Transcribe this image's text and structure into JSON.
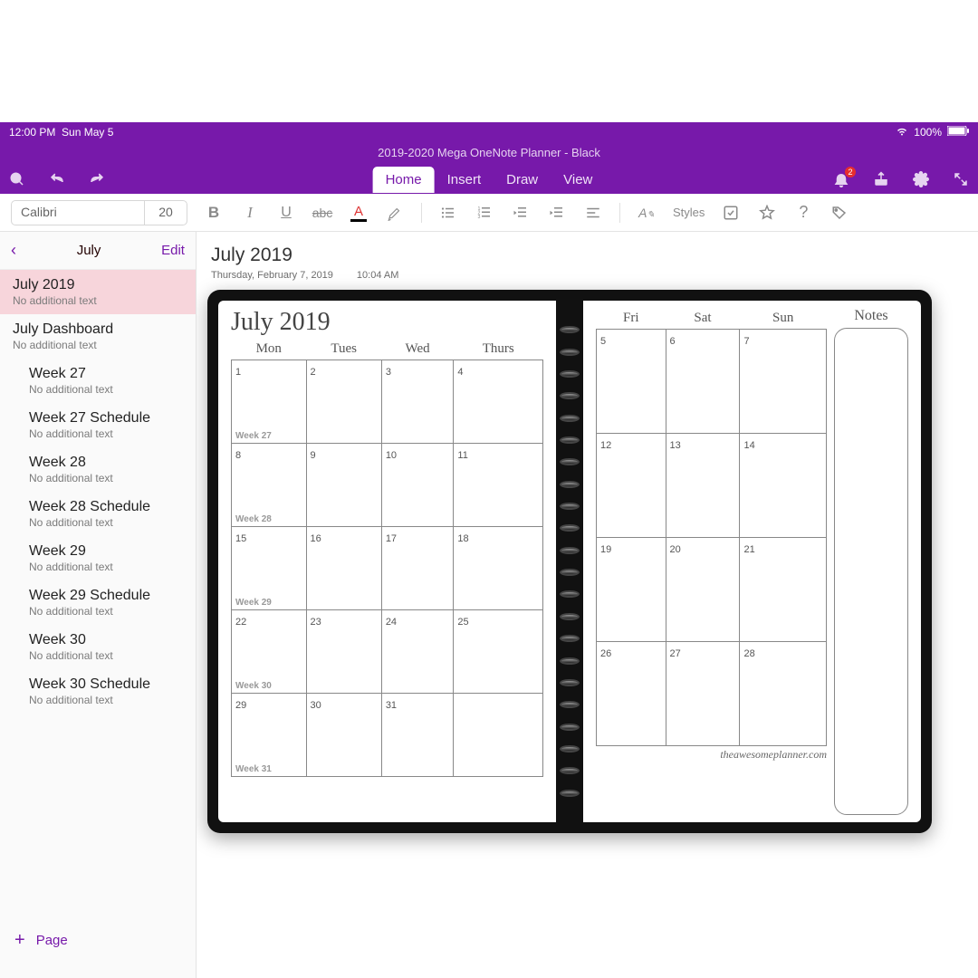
{
  "status": {
    "time": "12:00 PM",
    "date": "Sun May 5",
    "wifi": true,
    "battery_pct": "100%"
  },
  "title": "2019-2020 Mega OneNote Planner - Black",
  "tabs": [
    "Home",
    "Insert",
    "Draw",
    "View"
  ],
  "active_tab": "Home",
  "notifications_badge": "2",
  "toolbar": {
    "font_name": "Calibri",
    "font_size": "20",
    "styles_label": "Styles"
  },
  "sidebar": {
    "back_section": "July",
    "edit_label": "Edit",
    "items": [
      {
        "name": "July 2019",
        "sub": "No additional text",
        "selected": true,
        "indent": false
      },
      {
        "name": "July Dashboard",
        "sub": "No additional text",
        "selected": false,
        "indent": false
      },
      {
        "name": "Week 27",
        "sub": "No additional text",
        "selected": false,
        "indent": true
      },
      {
        "name": "Week 27 Schedule",
        "sub": "No additional text",
        "selected": false,
        "indent": true
      },
      {
        "name": "Week 28",
        "sub": "No additional text",
        "selected": false,
        "indent": true
      },
      {
        "name": "Week 28 Schedule",
        "sub": "No additional text",
        "selected": false,
        "indent": true
      },
      {
        "name": "Week 29",
        "sub": "No additional text",
        "selected": false,
        "indent": true
      },
      {
        "name": "Week 29 Schedule",
        "sub": "No additional text",
        "selected": false,
        "indent": true
      },
      {
        "name": "Week 30",
        "sub": "No additional text",
        "selected": false,
        "indent": true
      },
      {
        "name": "Week 30 Schedule",
        "sub": "No additional text",
        "selected": false,
        "indent": true
      }
    ],
    "add_page_label": "Page"
  },
  "page": {
    "title": "July 2019",
    "meta_date": "Thursday, February 7, 2019",
    "meta_time": "10:04 AM"
  },
  "planner": {
    "month_title": "July 2019",
    "notes_label": "Notes",
    "url": "theawesomeplanner.com",
    "left_headers": [
      "Mon",
      "Tues",
      "Wed",
      "Thurs"
    ],
    "right_headers": [
      "Fri",
      "Sat",
      "Sun"
    ],
    "rows": [
      {
        "left": [
          "1",
          "2",
          "3",
          "4"
        ],
        "right": [
          "5",
          "6",
          "7"
        ],
        "week": "Week 27"
      },
      {
        "left": [
          "8",
          "9",
          "10",
          "11"
        ],
        "right": [
          "12",
          "13",
          "14"
        ],
        "week": "Week 28"
      },
      {
        "left": [
          "15",
          "16",
          "17",
          "18"
        ],
        "right": [
          "19",
          "20",
          "21"
        ],
        "week": "Week 29"
      },
      {
        "left": [
          "22",
          "23",
          "24",
          "25"
        ],
        "right": [
          "26",
          "27",
          "28"
        ],
        "week": "Week 30"
      },
      {
        "left": [
          "29",
          "30",
          "31",
          ""
        ],
        "right": [
          "",
          "",
          ""
        ],
        "week": "Week 31"
      }
    ]
  }
}
